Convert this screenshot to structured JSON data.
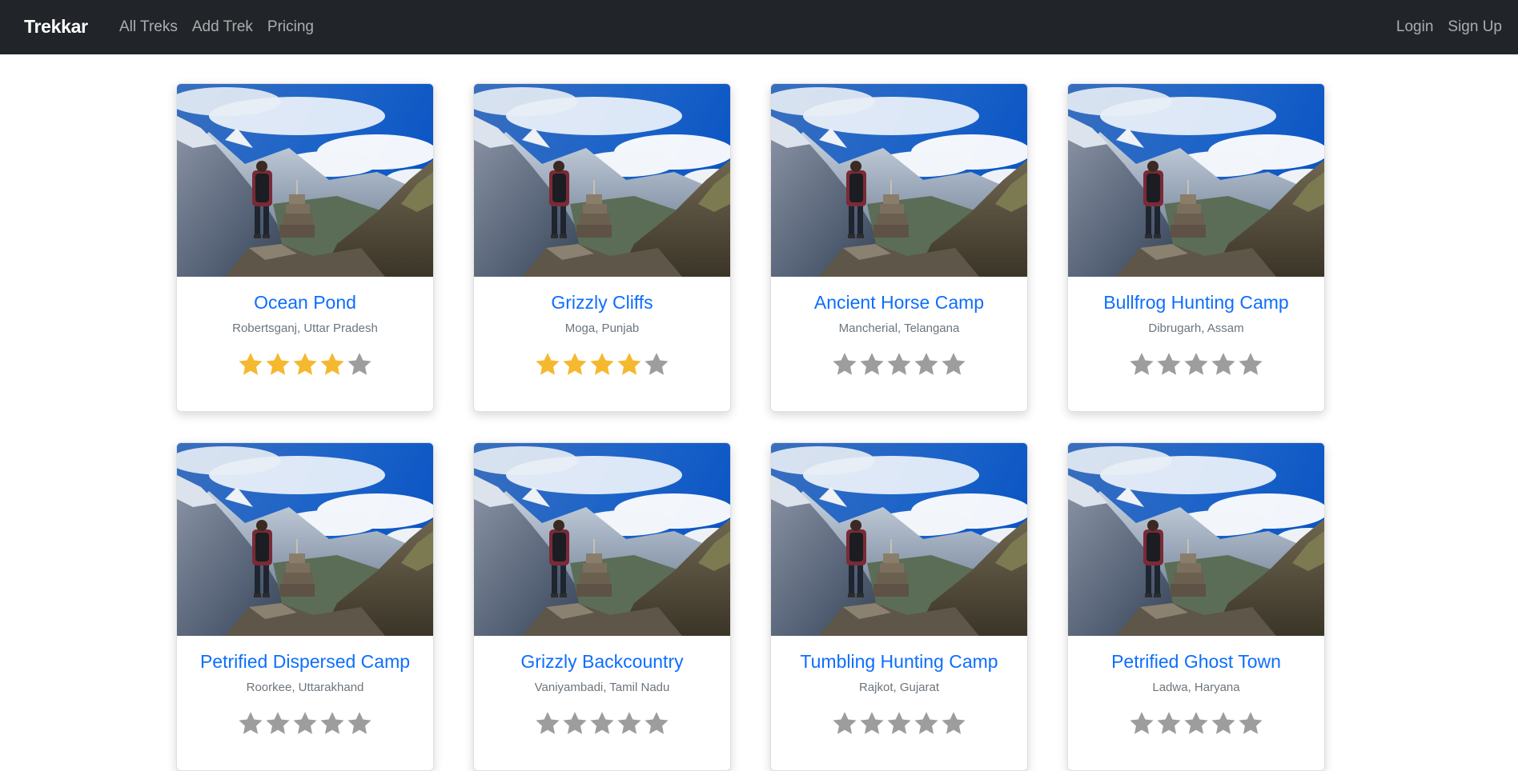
{
  "navbar": {
    "brand": "Trekkar",
    "links": [
      "All Treks",
      "Add Trek",
      "Pricing"
    ],
    "auth": [
      "Login",
      "Sign Up"
    ]
  },
  "colors": {
    "star_filled": "#f5b82e",
    "star_empty": "#9d9d9d",
    "title": "#0d6efd"
  },
  "treks": [
    {
      "name": "Ocean Pond",
      "location": "Robertsganj, Uttar Pradesh",
      "rating": 4
    },
    {
      "name": "Grizzly Cliffs",
      "location": "Moga, Punjab",
      "rating": 4
    },
    {
      "name": "Ancient Horse Camp",
      "location": "Mancherial, Telangana",
      "rating": 0
    },
    {
      "name": "Bullfrog Hunting Camp",
      "location": "Dibrugarh, Assam",
      "rating": 0
    },
    {
      "name": "Petrified Dispersed Camp",
      "location": "Roorkee, Uttarakhand",
      "rating": 0
    },
    {
      "name": "Grizzly Backcountry",
      "location": "Vaniyambadi, Tamil Nadu",
      "rating": 0
    },
    {
      "name": "Tumbling Hunting Camp",
      "location": "Rajkot, Gujarat",
      "rating": 0
    },
    {
      "name": "Petrified Ghost Town",
      "location": "Ladwa, Haryana",
      "rating": 0
    }
  ]
}
